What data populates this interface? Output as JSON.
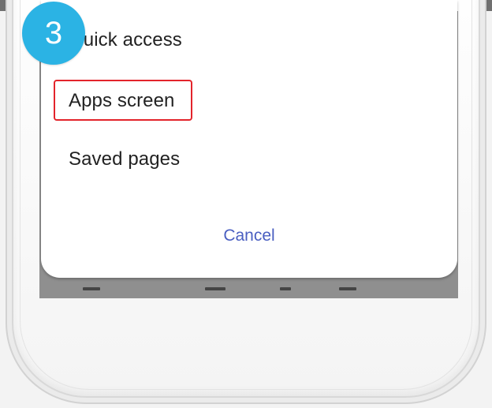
{
  "step_badge": {
    "number": "3",
    "color": "#2bb3e4"
  },
  "dialog": {
    "items": [
      {
        "label": "Quick access"
      },
      {
        "label": "Apps screen",
        "highlighted": true
      },
      {
        "label": "Saved pages"
      }
    ],
    "cancel_label": "Cancel",
    "highlight_color": "#e3242b",
    "cancel_color": "#4a5fc1"
  }
}
